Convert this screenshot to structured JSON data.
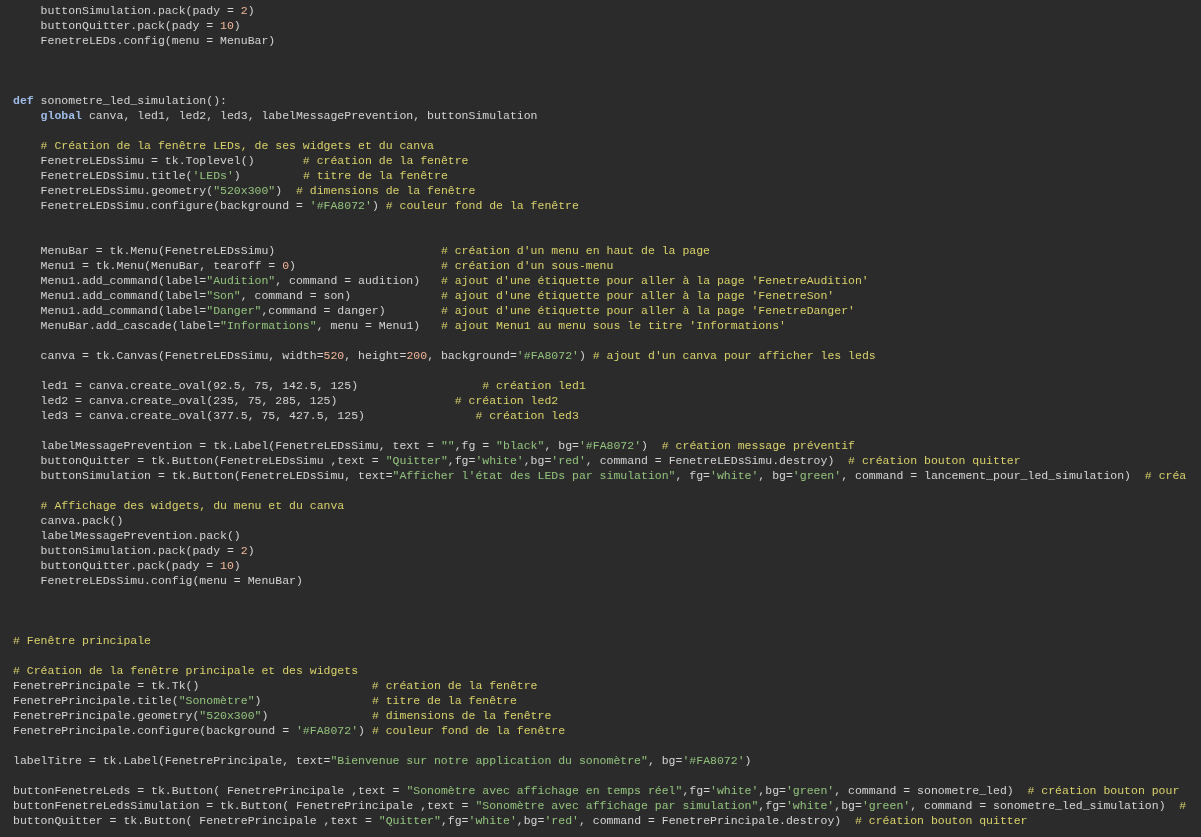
{
  "editor": {
    "lines": [
      {
        "kind": "code",
        "tokens": [
          {
            "kind": "plain",
            "text": "    buttonSimulation.pack(pady = "
          },
          {
            "kind": "number",
            "text": "2"
          },
          {
            "kind": "plain",
            "text": ")"
          }
        ]
      },
      {
        "kind": "code",
        "tokens": [
          {
            "kind": "plain",
            "text": "    buttonQuitter.pack(pady = "
          },
          {
            "kind": "number",
            "text": "10"
          },
          {
            "kind": "plain",
            "text": ")"
          }
        ]
      },
      {
        "kind": "code",
        "tokens": [
          {
            "kind": "plain",
            "text": "    FenetreLEDs.config(menu = MenuBar)"
          }
        ]
      },
      {
        "kind": "blank"
      },
      {
        "kind": "blank"
      },
      {
        "kind": "blank"
      },
      {
        "kind": "code",
        "tokens": [
          {
            "kind": "keyword",
            "text": "def"
          },
          {
            "kind": "plain",
            "text": " sonometre_led_simulation():"
          }
        ]
      },
      {
        "kind": "code",
        "tokens": [
          {
            "kind": "keyword",
            "text": "    global"
          },
          {
            "kind": "plain",
            "text": " canva, led1, led2, led3, labelMessagePrevention, buttonSimulation"
          }
        ]
      },
      {
        "kind": "blank"
      },
      {
        "kind": "code",
        "tokens": [
          {
            "kind": "comment",
            "text": "    # Création de la fenêtre LEDs, de ses widgets et du canva"
          }
        ]
      },
      {
        "kind": "code",
        "tokens": [
          {
            "kind": "plain",
            "text": "    FenetreLEDsSimu = tk.Toplevel()       "
          },
          {
            "kind": "comment",
            "text": "# création de la fenêtre"
          }
        ]
      },
      {
        "kind": "code",
        "tokens": [
          {
            "kind": "plain",
            "text": "    FenetreLEDsSimu.title("
          },
          {
            "kind": "string",
            "text": "'LEDs'"
          },
          {
            "kind": "plain",
            "text": ")         "
          },
          {
            "kind": "comment",
            "text": "# titre de la fenêtre"
          }
        ]
      },
      {
        "kind": "code",
        "tokens": [
          {
            "kind": "plain",
            "text": "    FenetreLEDsSimu.geometry("
          },
          {
            "kind": "string",
            "text": "\"520x300\""
          },
          {
            "kind": "plain",
            "text": ")  "
          },
          {
            "kind": "comment",
            "text": "# dimensions de la fenêtre"
          }
        ]
      },
      {
        "kind": "code",
        "tokens": [
          {
            "kind": "plain",
            "text": "    FenetreLEDsSimu.configure(background = "
          },
          {
            "kind": "string",
            "text": "'#FA8072'"
          },
          {
            "kind": "plain",
            "text": ") "
          },
          {
            "kind": "comment",
            "text": "# couleur fond de la fenêtre"
          }
        ]
      },
      {
        "kind": "blank"
      },
      {
        "kind": "blank"
      },
      {
        "kind": "code",
        "tokens": [
          {
            "kind": "plain",
            "text": "    MenuBar = tk.Menu(FenetreLEDsSimu)                        "
          },
          {
            "kind": "comment",
            "text": "# création d'un menu en haut de la page"
          }
        ]
      },
      {
        "kind": "code",
        "tokens": [
          {
            "kind": "plain",
            "text": "    Menu1 = tk.Menu(MenuBar, tearoff = "
          },
          {
            "kind": "number",
            "text": "0"
          },
          {
            "kind": "plain",
            "text": ")                     "
          },
          {
            "kind": "comment",
            "text": "# création d'un sous-menu"
          }
        ]
      },
      {
        "kind": "code",
        "tokens": [
          {
            "kind": "plain",
            "text": "    Menu1.add_command(label="
          },
          {
            "kind": "string",
            "text": "\"Audition\""
          },
          {
            "kind": "plain",
            "text": ", command = audition)   "
          },
          {
            "kind": "comment",
            "text": "# ajout d'une étiquette pour aller à la page 'FenetreAudition'"
          }
        ]
      },
      {
        "kind": "code",
        "tokens": [
          {
            "kind": "plain",
            "text": "    Menu1.add_command(label="
          },
          {
            "kind": "string",
            "text": "\"Son\""
          },
          {
            "kind": "plain",
            "text": ", command = son)             "
          },
          {
            "kind": "comment",
            "text": "# ajout d'une étiquette pour aller à la page 'FenetreSon'"
          }
        ]
      },
      {
        "kind": "code",
        "tokens": [
          {
            "kind": "plain",
            "text": "    Menu1.add_command(label="
          },
          {
            "kind": "string",
            "text": "\"Danger\""
          },
          {
            "kind": "plain",
            "text": ",command = danger)        "
          },
          {
            "kind": "comment",
            "text": "# ajout d'une étiquette pour aller à la page 'FenetreDanger'"
          }
        ]
      },
      {
        "kind": "code",
        "tokens": [
          {
            "kind": "plain",
            "text": "    MenuBar.add_cascade(label="
          },
          {
            "kind": "string",
            "text": "\"Informations\""
          },
          {
            "kind": "plain",
            "text": ", menu = Menu1)   "
          },
          {
            "kind": "comment",
            "text": "# ajout Menu1 au menu sous le titre 'Informations'"
          }
        ]
      },
      {
        "kind": "blank"
      },
      {
        "kind": "code",
        "tokens": [
          {
            "kind": "plain",
            "text": "    canva = tk.Canvas(FenetreLEDsSimu, width="
          },
          {
            "kind": "number",
            "text": "520"
          },
          {
            "kind": "plain",
            "text": ", height="
          },
          {
            "kind": "number",
            "text": "200"
          },
          {
            "kind": "plain",
            "text": ", background="
          },
          {
            "kind": "string",
            "text": "'#FA8072'"
          },
          {
            "kind": "plain",
            "text": ") "
          },
          {
            "kind": "comment",
            "text": "# ajout d'un canva pour afficher les leds"
          }
        ]
      },
      {
        "kind": "blank"
      },
      {
        "kind": "code",
        "tokens": [
          {
            "kind": "plain",
            "text": "    led1 = canva.create_oval(92.5, 75, 142.5, 125)                  "
          },
          {
            "kind": "comment",
            "text": "# création led1"
          }
        ]
      },
      {
        "kind": "code",
        "tokens": [
          {
            "kind": "plain",
            "text": "    led2 = canva.create_oval(235, 75, 285, 125)                 "
          },
          {
            "kind": "comment",
            "text": "# création led2"
          }
        ]
      },
      {
        "kind": "code",
        "tokens": [
          {
            "kind": "plain",
            "text": "    led3 = canva.create_oval(377.5, 75, 427.5, 125)                "
          },
          {
            "kind": "comment",
            "text": "# création led3"
          }
        ]
      },
      {
        "kind": "blank"
      },
      {
        "kind": "code",
        "tokens": [
          {
            "kind": "plain",
            "text": "    labelMessagePrevention = tk.Label(FenetreLEDsSimu, text = "
          },
          {
            "kind": "string",
            "text": "\"\""
          },
          {
            "kind": "plain",
            "text": ",fg = "
          },
          {
            "kind": "string",
            "text": "\"black\""
          },
          {
            "kind": "plain",
            "text": ", bg="
          },
          {
            "kind": "string",
            "text": "'#FA8072'"
          },
          {
            "kind": "plain",
            "text": ")  "
          },
          {
            "kind": "comment",
            "text": "# création message préventif"
          }
        ]
      },
      {
        "kind": "code",
        "tokens": [
          {
            "kind": "plain",
            "text": "    buttonQuitter = tk.Button(FenetreLEDsSimu ,text = "
          },
          {
            "kind": "string",
            "text": "\"Quitter\""
          },
          {
            "kind": "plain",
            "text": ",fg="
          },
          {
            "kind": "string",
            "text": "'white'"
          },
          {
            "kind": "plain",
            "text": ",bg="
          },
          {
            "kind": "string",
            "text": "'red'"
          },
          {
            "kind": "plain",
            "text": ", command = FenetreLEDsSimu.destroy)  "
          },
          {
            "kind": "comment",
            "text": "# création bouton quitter"
          }
        ]
      },
      {
        "kind": "code",
        "tokens": [
          {
            "kind": "plain",
            "text": "    buttonSimulation = tk.Button(FenetreLEDsSimu, text="
          },
          {
            "kind": "string",
            "text": "\"Afficher l'état des LEDs par simulation\""
          },
          {
            "kind": "plain",
            "text": ", fg="
          },
          {
            "kind": "string",
            "text": "'white'"
          },
          {
            "kind": "plain",
            "text": ", bg="
          },
          {
            "kind": "string",
            "text": "'green'"
          },
          {
            "kind": "plain",
            "text": ", command = lancement_pour_led_simulation)  "
          },
          {
            "kind": "comment",
            "text": "# créa"
          }
        ]
      },
      {
        "kind": "blank"
      },
      {
        "kind": "code",
        "tokens": [
          {
            "kind": "comment",
            "text": "    # Affichage des widgets, du menu et du canva"
          }
        ]
      },
      {
        "kind": "code",
        "tokens": [
          {
            "kind": "plain",
            "text": "    canva.pack()"
          }
        ]
      },
      {
        "kind": "code",
        "tokens": [
          {
            "kind": "plain",
            "text": "    labelMessagePrevention.pack()"
          }
        ]
      },
      {
        "kind": "code",
        "tokens": [
          {
            "kind": "plain",
            "text": "    buttonSimulation.pack(pady = "
          },
          {
            "kind": "number",
            "text": "2"
          },
          {
            "kind": "plain",
            "text": ")"
          }
        ]
      },
      {
        "kind": "code",
        "tokens": [
          {
            "kind": "plain",
            "text": "    buttonQuitter.pack(pady = "
          },
          {
            "kind": "number",
            "text": "10"
          },
          {
            "kind": "plain",
            "text": ")"
          }
        ]
      },
      {
        "kind": "code",
        "tokens": [
          {
            "kind": "plain",
            "text": "    FenetreLEDsSimu.config(menu = MenuBar)"
          }
        ]
      },
      {
        "kind": "blank"
      },
      {
        "kind": "blank"
      },
      {
        "kind": "blank"
      },
      {
        "kind": "code",
        "tokens": [
          {
            "kind": "comment",
            "text": "# Fenêtre principale"
          }
        ]
      },
      {
        "kind": "blank"
      },
      {
        "kind": "code",
        "tokens": [
          {
            "kind": "comment",
            "text": "# Création de la fenêtre principale et des widgets"
          }
        ]
      },
      {
        "kind": "code",
        "tokens": [
          {
            "kind": "plain",
            "text": "FenetrePrincipale = tk.Tk()                         "
          },
          {
            "kind": "comment",
            "text": "# création de la fenêtre"
          }
        ]
      },
      {
        "kind": "code",
        "tokens": [
          {
            "kind": "plain",
            "text": "FenetrePrincipale.title("
          },
          {
            "kind": "string",
            "text": "\"Sonomètre\""
          },
          {
            "kind": "plain",
            "text": ")                "
          },
          {
            "kind": "comment",
            "text": "# titre de la fenêtre"
          }
        ]
      },
      {
        "kind": "code",
        "tokens": [
          {
            "kind": "plain",
            "text": "FenetrePrincipale.geometry("
          },
          {
            "kind": "string",
            "text": "\"520x300\""
          },
          {
            "kind": "plain",
            "text": ")               "
          },
          {
            "kind": "comment",
            "text": "# dimensions de la fenêtre"
          }
        ]
      },
      {
        "kind": "code",
        "tokens": [
          {
            "kind": "plain",
            "text": "FenetrePrincipale.configure(background = "
          },
          {
            "kind": "string",
            "text": "'#FA8072'"
          },
          {
            "kind": "plain",
            "text": ") "
          },
          {
            "kind": "comment",
            "text": "# couleur fond de la fenêtre"
          }
        ]
      },
      {
        "kind": "blank"
      },
      {
        "kind": "code",
        "tokens": [
          {
            "kind": "plain",
            "text": "labelTitre = tk.Label(FenetrePrincipale, text="
          },
          {
            "kind": "string",
            "text": "\"Bienvenue sur notre application du sonomètre\""
          },
          {
            "kind": "plain",
            "text": ", bg="
          },
          {
            "kind": "string",
            "text": "'#FA8072'"
          },
          {
            "kind": "plain",
            "text": ")"
          }
        ]
      },
      {
        "kind": "blank"
      },
      {
        "kind": "code",
        "tokens": [
          {
            "kind": "plain",
            "text": "buttonFenetreLeds = tk.Button( FenetrePrincipale ,text = "
          },
          {
            "kind": "string",
            "text": "\"Sonomètre avec affichage en temps réel\""
          },
          {
            "kind": "plain",
            "text": ",fg="
          },
          {
            "kind": "string",
            "text": "'white'"
          },
          {
            "kind": "plain",
            "text": ",bg="
          },
          {
            "kind": "string",
            "text": "'green'"
          },
          {
            "kind": "plain",
            "text": ", command = sonometre_led)  "
          },
          {
            "kind": "comment",
            "text": "# création bouton pour"
          }
        ]
      },
      {
        "kind": "code",
        "tokens": [
          {
            "kind": "plain",
            "text": "buttonFenetreLedsSimulation = tk.Button( FenetrePrincipale ,text = "
          },
          {
            "kind": "string",
            "text": "\"Sonomètre avec affichage par simulation\""
          },
          {
            "kind": "plain",
            "text": ",fg="
          },
          {
            "kind": "string",
            "text": "'white'"
          },
          {
            "kind": "plain",
            "text": ",bg="
          },
          {
            "kind": "string",
            "text": "'green'"
          },
          {
            "kind": "plain",
            "text": ", command = sonometre_led_simulation)  "
          },
          {
            "kind": "comment",
            "text": "#"
          }
        ]
      },
      {
        "kind": "code",
        "tokens": [
          {
            "kind": "plain",
            "text": "buttonQuitter = tk.Button( FenetrePrincipale ,text = "
          },
          {
            "kind": "string",
            "text": "\"Quitter\""
          },
          {
            "kind": "plain",
            "text": ",fg="
          },
          {
            "kind": "string",
            "text": "'white'"
          },
          {
            "kind": "plain",
            "text": ",bg="
          },
          {
            "kind": "string",
            "text": "'red'"
          },
          {
            "kind": "plain",
            "text": ", command = FenetrePrincipale.destroy)  "
          },
          {
            "kind": "comment",
            "text": "# création bouton quitter"
          }
        ]
      }
    ]
  }
}
